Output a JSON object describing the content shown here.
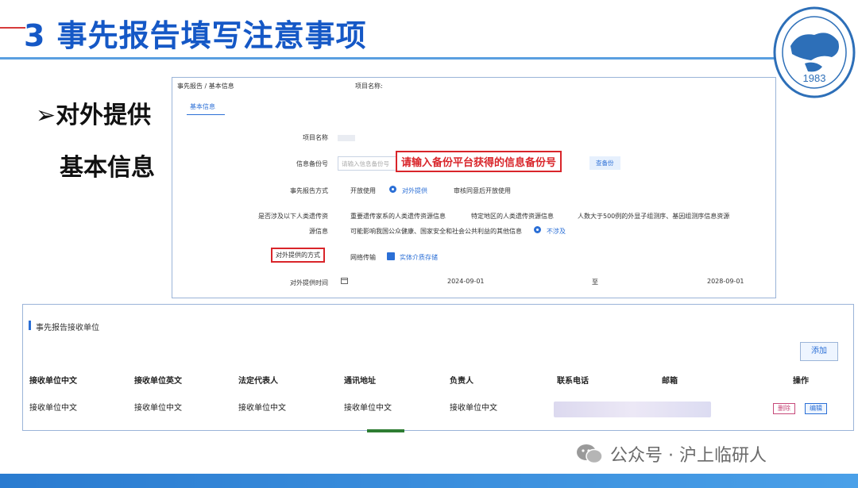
{
  "slide": {
    "title": "3  事先报告填写注意事项",
    "bullet_line1": "➢对外提供",
    "bullet_line2": "基本信息"
  },
  "seal": {
    "year": "1983"
  },
  "form": {
    "breadcrumb": "事先报告 / 基本信息",
    "project_name_header": "项目名称:",
    "tab_label": "基本信息",
    "fields": {
      "project_name_label": "项目名称",
      "backup_no_label": "信息备份号",
      "backup_no_placeholder": "请输入信息备份号",
      "backup_no_callout": "请输入备份平台获得的信息备份号",
      "query_button": "查备份",
      "report_mode_label": "事先报告方式",
      "report_mode_options": [
        "开放使用",
        "对外提供",
        "审核同意后开放使用"
      ],
      "report_mode_selected": "对外提供",
      "involve_label_line1": "是否涉及以下人类遗传资",
      "involve_label_line2": "源信息",
      "involve_options_line1": [
        "重要遗传家系的人类遗传资源信息",
        "特定地区的人类遗传资源信息",
        "人数大于500例的外显子组测序、基因组测序信息资源"
      ],
      "involve_options_line2": "可能影响我国公众健康、国家安全和社会公共利益的其他信息",
      "involve_selected": "不涉及",
      "provide_mode_label": "对外提供的方式",
      "provide_mode_options": [
        "网络传输",
        "实体介质存储"
      ],
      "provide_mode_checked": "实体介质存储",
      "provide_time_label": "对外提供时间",
      "date_start": "2024-09-01",
      "date_to": "至",
      "date_end": "2028-09-01"
    }
  },
  "receiving": {
    "title": "事先报告接收单位",
    "add_button": "添加",
    "headers": [
      "接收单位中文",
      "接收单位英文",
      "法定代表人",
      "通讯地址",
      "负责人",
      "联系电话",
      "邮箱",
      "操作"
    ],
    "row": [
      "接收单位中文",
      "接收单位中文",
      "接收单位中文",
      "接收单位中文",
      "接收单位中文"
    ],
    "delete_button": "删除",
    "edit_button": "编辑"
  },
  "watermark": {
    "text": "公众号 · 沪上临研人"
  },
  "colors": {
    "title_blue": "#1558c6",
    "accent_blue": "#2b6fd6",
    "callout_red": "#d9252a"
  }
}
